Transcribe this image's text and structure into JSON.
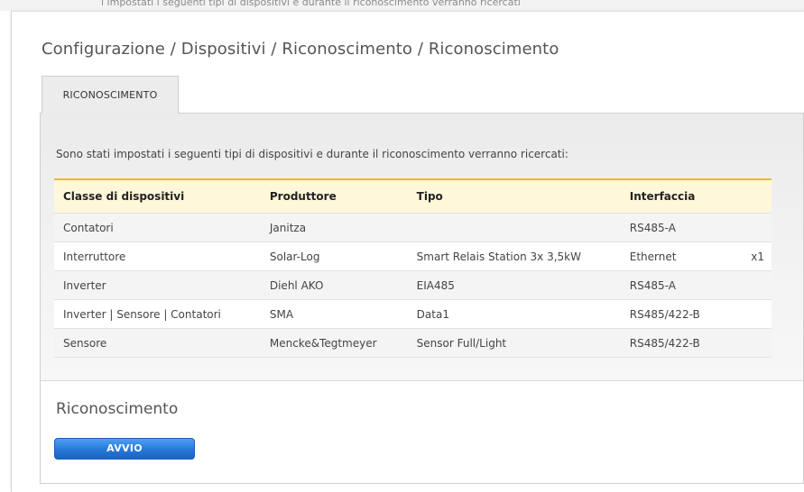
{
  "top_cut_text": "i impostati i seguenti tipi di dispositivi e durante il riconoscimento verranno ricercati",
  "breadcrumb": "Configurazione / Dispositivi / Riconoscimento / Riconoscimento",
  "tab_label": "RICONOSCIMENTO",
  "intro_text": "Sono stati impostati i seguenti tipi di dispositivi e durante il riconoscimento verranno ricercati:",
  "table": {
    "headers": [
      "Classe di dispositivi",
      "Produttore",
      "Tipo",
      "Interfaccia",
      ""
    ],
    "rows": [
      [
        "Contatori",
        "Janitza",
        "",
        "RS485-A",
        ""
      ],
      [
        "Interruttore",
        "Solar-Log",
        "Smart Relais Station 3x 3,5kW",
        "Ethernet",
        "x1"
      ],
      [
        "Inverter",
        "Diehl AKO",
        "EIA485",
        "RS485-A",
        ""
      ],
      [
        "Inverter | Sensore | Contatori",
        "SMA",
        "Data1",
        "RS485/422-B",
        ""
      ],
      [
        "Sensore",
        "Mencke&Tegtmeyer",
        "Sensor Full/Light",
        "RS485/422-B",
        ""
      ]
    ]
  },
  "section_title": "Riconoscimento",
  "start_button": "AVVIO",
  "colors": {
    "accent": "#f2b535",
    "button": "#2478d8"
  }
}
